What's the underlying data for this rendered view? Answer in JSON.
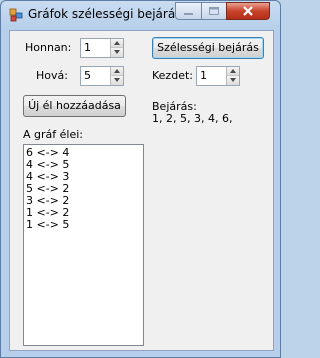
{
  "window": {
    "title": "Gráfok szélességi bejárása"
  },
  "form": {
    "honnan_label": "Honnan:",
    "honnan_value": "1",
    "hova_label": "Hová:",
    "hova_value": "5",
    "add_edge_button": "Új él hozzáadása",
    "edges_label": "A gráf élei:",
    "edges": [
      "6 <-> 4",
      "4 <-> 5",
      "4 <-> 3",
      "5 <-> 2",
      "3 <-> 2",
      "1 <-> 2",
      "1 <-> 5"
    ],
    "bfs_button": "Szélességi bejárás",
    "kezdet_label": "Kezdet:",
    "kezdet_value": "1",
    "bejaras_label": "Bejárás:",
    "bejaras_result": "1, 2, 5, 3, 4, 6,"
  }
}
